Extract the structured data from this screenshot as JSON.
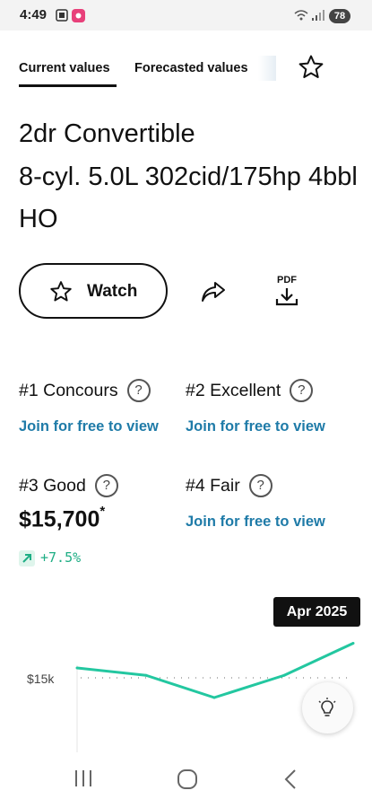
{
  "status": {
    "time": "4:49",
    "battery": "78",
    "icons": [
      "screenshot-icon",
      "app-notification-icon",
      "wifi-icon",
      "signal-icon",
      "battery-icon"
    ]
  },
  "tabs": [
    {
      "label": "Current values",
      "active": true
    },
    {
      "label": "Forecasted values",
      "active": false
    }
  ],
  "vehicle": {
    "body_style": "2dr Convertible",
    "engine": "8-cyl. 5.0L 302cid/175hp 4bbl HO"
  },
  "actions": {
    "watch_label": "Watch",
    "pdf_label": "PDF"
  },
  "conditions": [
    {
      "label": "#1 Concours",
      "value": "Join for free to view"
    },
    {
      "label": "#2 Excellent",
      "value": "Join for free to view"
    },
    {
      "label": "#3 Good",
      "value": "$15,700",
      "footnote": "*",
      "change": "+7.5%"
    },
    {
      "label": "#4 Fair",
      "value": "Join for free to view"
    }
  ],
  "help_glyph": "?",
  "chart": {
    "tooltip_date": "Apr 2025",
    "tick_label": "$15k",
    "line_color": "#23c7a0",
    "accent_color": "#1f7ba8"
  },
  "chart_data": {
    "type": "line",
    "y_tick_labels": [
      "$15k"
    ],
    "series": [
      {
        "values": [
          15200,
          15050,
          14600,
          15050,
          15700
        ]
      }
    ],
    "highlight": "Apr 2025",
    "grid": "dotted reference line at $15k"
  }
}
